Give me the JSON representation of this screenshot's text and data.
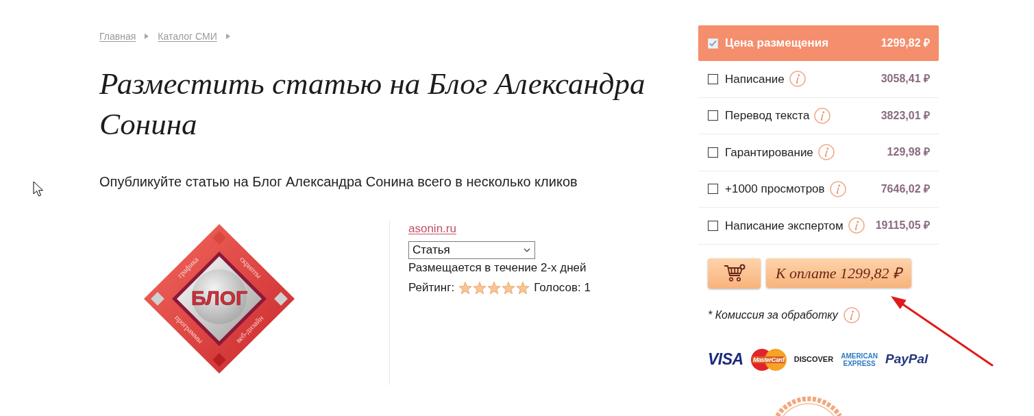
{
  "breadcrumb": [
    "Главная",
    "Каталог СМИ"
  ],
  "title": "Разместить статью на Блог Александра Сонина",
  "subtitle": "Опубликуйте статью на Блог Александра Сонина всего в несколько кликов",
  "logo": {
    "title": "БЛОГ",
    "words": [
      "графика",
      "скрипты",
      "программы",
      "веб-дизайн"
    ]
  },
  "site": {
    "link": "asonin.ru",
    "type_select": {
      "value": "Статья"
    },
    "placement_time": "Размещается в течение 2-х дней",
    "rating": {
      "label": "Рейтинг:",
      "stars": 5,
      "votes": "Голосов: 1"
    }
  },
  "price_panel": {
    "rows": [
      {
        "label": "Цена размещения",
        "price": "1299,82 ₽",
        "checked": true,
        "info": false
      },
      {
        "label": "Написание",
        "price": "3058,41 ₽",
        "checked": false,
        "info": true
      },
      {
        "label": "Перевод текста",
        "price": "3823,01 ₽",
        "checked": false,
        "info": true
      },
      {
        "label": "Гарантирование",
        "price": "129,98 ₽",
        "checked": false,
        "info": true
      },
      {
        "label": "+1000 просмотров",
        "price": "7646,02 ₽",
        "checked": false,
        "info": true
      },
      {
        "label": "Написание экспертом",
        "price": "19115,05 ₽",
        "checked": false,
        "info": true
      }
    ],
    "pay_button": "К оплате 1299,82 ₽",
    "commission": "* Комиссия за обработку",
    "payment_methods": [
      {
        "kind": "visa",
        "text": "VISA"
      },
      {
        "kind": "mastercard",
        "text": "MasterCard"
      },
      {
        "kind": "discover",
        "text": "DISCOVER"
      },
      {
        "kind": "amex",
        "lines": [
          "AMERICAN",
          "EXPRESS"
        ]
      },
      {
        "kind": "paypal",
        "text": "PayPal"
      }
    ]
  }
}
